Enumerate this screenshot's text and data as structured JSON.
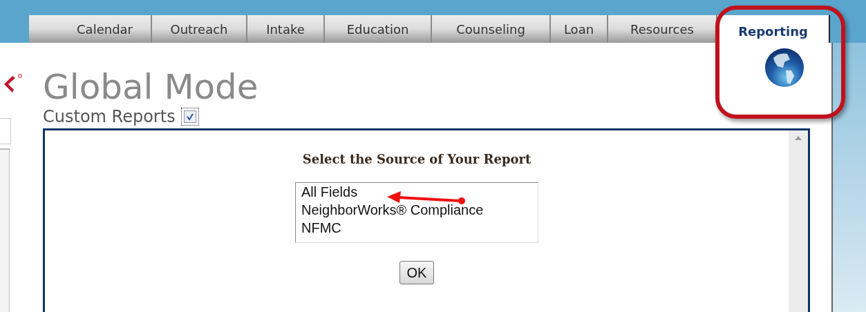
{
  "tabs": [
    {
      "label": "Calendar",
      "selected": false
    },
    {
      "label": "Outreach",
      "selected": false
    },
    {
      "label": "Intake",
      "selected": false
    },
    {
      "label": "Education",
      "selected": false
    },
    {
      "label": "Counseling",
      "selected": false
    },
    {
      "label": "Loan",
      "selected": false
    },
    {
      "label": "Resources",
      "selected": false
    },
    {
      "label": "Reporting",
      "selected": true
    }
  ],
  "header": {
    "title": "Global Mode",
    "custom_reports": {
      "label": "Custom Reports",
      "checked": true
    }
  },
  "dialog": {
    "heading": "Select the Source of Your Report",
    "sources": [
      "All Fields",
      "NeighborWorks® Compliance",
      "NFMC"
    ],
    "ok_button": "OK"
  }
}
